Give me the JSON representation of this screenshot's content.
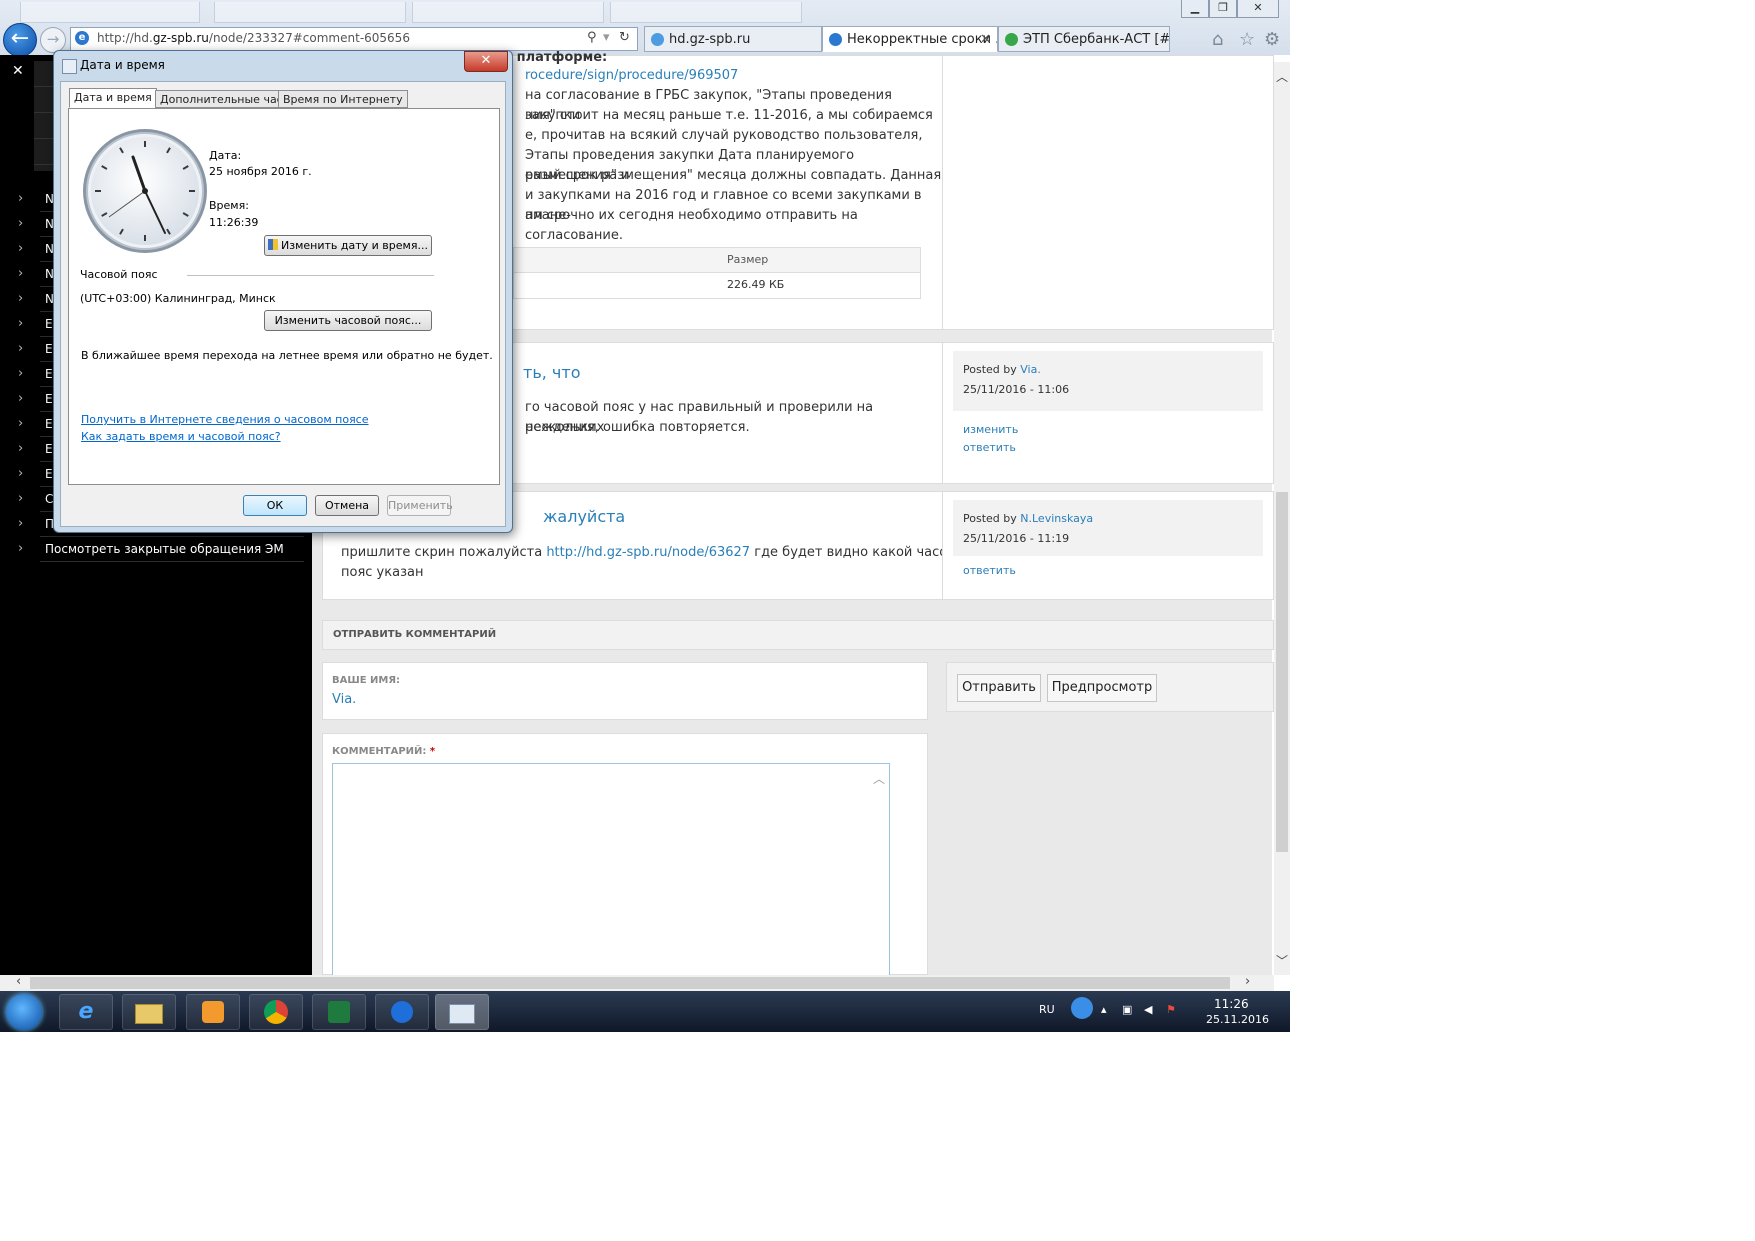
{
  "browser": {
    "url": "http://hd.gz-spb.ru/node/233327#comment-605656",
    "url_prefix": "http://hd.",
    "url_domain": "gz-spb.ru",
    "url_path": "/node/233327#comment-605656",
    "tabs": [
      {
        "label": "hd.gz-spb.ru",
        "active": false
      },
      {
        "label": "Некорректные сроки ...",
        "active": true
      },
      {
        "label": "ЭТП Сбербанк-АСТ [#F2]",
        "active": false
      }
    ]
  },
  "sidebar": {
    "letters": [
      "N",
      "N",
      "N",
      "N",
      "N",
      "E",
      "E",
      "E",
      "E",
      "E",
      "E",
      "E",
      "C",
      "П"
    ],
    "last_item": "Посмотреть закрытые обращения ЭМ"
  },
  "page": {
    "post1": {
      "heading_fragment": "и платформе:",
      "link": "rocedure/sign/procedure/969507",
      "lines": [
        "на согласование в ГРБС закупок, \"Этапы проведения закупки",
        "ния\" стоит на месяц раньше т.е. 11-2016, а мы собираемся",
        "е, прочитав на всякий случай руководство пользователя,",
        "Этапы проведения закупки Дата планируемого размещения\" и",
        "емый срок размещения\" месяца должны совпадать. Данная",
        "и закупками на 2016 год и главное со всеми закупками в плане-",
        "ам срочно их сегодня необходимо отправить на согласование."
      ],
      "file_header_size": "Размер",
      "file_size": "226.49 КБ"
    },
    "comment1": {
      "title_fragment": "ть, что",
      "lines": [
        "го часовой пояс у нас правильный и проверили на нескольких",
        "реждения, ошибка повторяется."
      ],
      "posted_by": "Posted by",
      "author": "Via.",
      "date": "25/11/2016 - 11:06",
      "edit": "изменить",
      "reply": "ответить"
    },
    "comment2": {
      "title_fragment": "жалуйста",
      "text_before": "пришлите скрин пожалуйста",
      "link": "http://hd.gz-spb.ru/node/63627",
      "text_after": "где будет видно какой часовой",
      "line2": "пояс указан",
      "posted_by": "Posted by",
      "author": "N.Levinskaya",
      "date": "25/11/2016 - 11:19",
      "reply": "ответить"
    },
    "comment_form": {
      "section_title": "ОТПРАВИТЬ КОММЕНТАРИЙ",
      "name_label": "ВАШЕ ИМЯ:",
      "name_value": "Via.",
      "comment_label": "КОММЕНТАРИЙ:",
      "required_mark": "*",
      "submit": "Отправить",
      "preview": "Предпросмотр"
    }
  },
  "dialog": {
    "title": "Дата и время",
    "tabs": [
      "Дата и время",
      "Дополнительные часы",
      "Время по Интернету"
    ],
    "date_label": "Дата:",
    "date_value": "25 ноября 2016 г.",
    "time_label": "Время:",
    "time_value": "11:26:39",
    "change_datetime_button": "Изменить дату и время...",
    "timezone_label": "Часовой пояс",
    "timezone_value": "(UTC+03:00) Калининград, Минск",
    "change_timezone_button": "Изменить часовой пояс...",
    "dst_note": "В ближайшее время перехода на летнее время или обратно не будет.",
    "link1": "Получить в Интернете сведения о часовом поясе",
    "link2": "Как задать время и часовой пояс?",
    "ok": "ОК",
    "cancel": "Отмена",
    "apply": "Применить"
  },
  "taskbar": {
    "lang": "RU",
    "time": "11:26",
    "date": "25.11.2016"
  }
}
